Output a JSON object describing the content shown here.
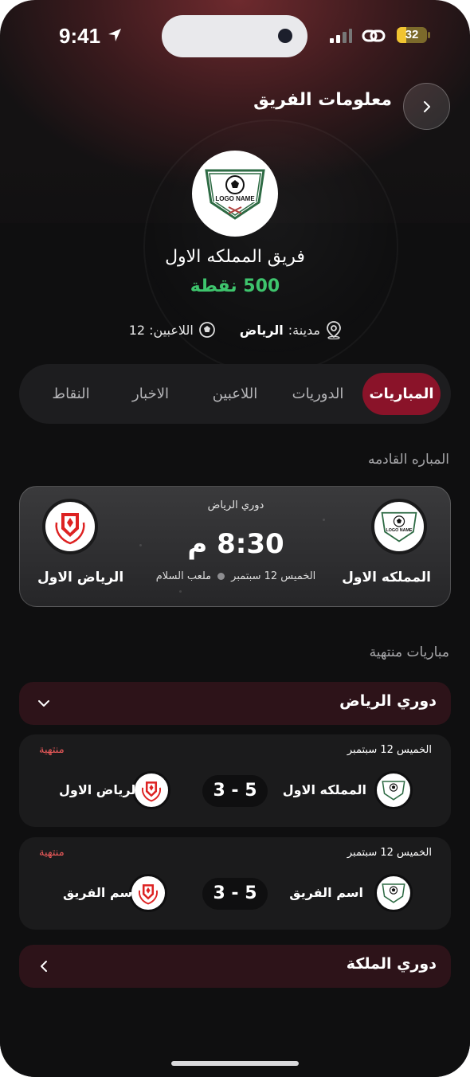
{
  "status_bar": {
    "time": "9:41",
    "battery": "32",
    "battery_level": 0.32
  },
  "header": {
    "title": "معلومات الفريق"
  },
  "team": {
    "logo_text": "LOGO NAME",
    "name": "فريق المملكه الاول",
    "points": "500 نقطة",
    "city_label": "مدينة:",
    "city": "الرياض",
    "players_label": "اللاعبين: 12"
  },
  "tabs": [
    {
      "label": "المباريات",
      "active": true
    },
    {
      "label": "الدوريات",
      "active": false
    },
    {
      "label": "اللاعبين",
      "active": false
    },
    {
      "label": "الاخبار",
      "active": false
    },
    {
      "label": "النقاط",
      "active": false
    }
  ],
  "upcoming": {
    "section_title": "المباره القادمه",
    "league": "دوري الرياض",
    "time": "8:30 م",
    "date": "الخميس 12 سبتمبر",
    "venue": "ملعب السلام",
    "home": {
      "name": "المملكه الاول",
      "logo_text": "LOGO NAME"
    },
    "away": {
      "name": "الرياض الاول"
    }
  },
  "finished": {
    "section_title": "مباريات منتهية",
    "leagues": [
      {
        "name": "دوري الرياض",
        "expanded": true,
        "matches": [
          {
            "date": "الخميس 12 سبتمبر",
            "status": "منتهية",
            "home": "المملكه الاول",
            "away": "الرياض الاول",
            "score": "5 - 3"
          },
          {
            "date": "الخميس 12 سبتمبر",
            "status": "منتهية",
            "home": "اسم الفريق",
            "away": "اسم الفريق",
            "score": "5 - 3"
          }
        ]
      },
      {
        "name": "دوري الملكة",
        "expanded": false
      }
    ]
  },
  "colors": {
    "accent": "#8a1329",
    "points": "#3ec46d",
    "finished": "#ec5a5a",
    "league_bar": "#2d1319"
  }
}
